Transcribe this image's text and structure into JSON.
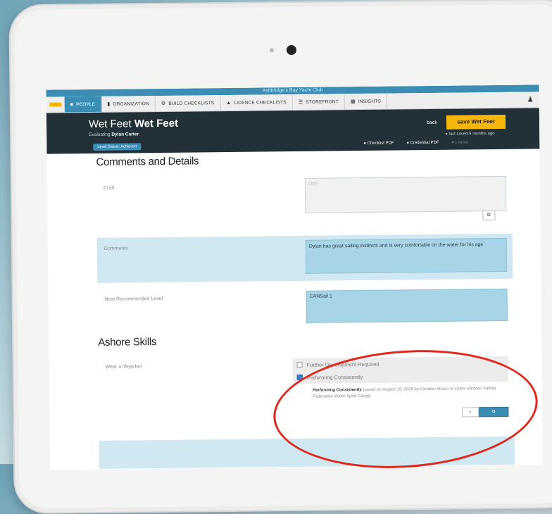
{
  "topbar": {
    "text": "Ashbridge's Bay Yacht Club"
  },
  "nav": {
    "tabs": [
      {
        "label": "PEOPLE",
        "icon": "people-icon",
        "active": true
      },
      {
        "label": "ORGANIZATION",
        "icon": "building-icon",
        "active": false
      },
      {
        "label": "BUILD CHECKLISTS",
        "icon": "gear-icon",
        "active": false
      },
      {
        "label": "LICENCE CHECKLISTS",
        "icon": "warning-icon",
        "active": false
      },
      {
        "label": "STOREFRONT",
        "icon": "store-icon",
        "active": false
      },
      {
        "label": "INSIGHTS",
        "icon": "chart-icon",
        "active": false
      }
    ],
    "user_icon": "user-icon"
  },
  "header": {
    "title_light": "Wet Feet",
    "title_bold": "Wet Feet",
    "sub_prefix": "Evaluating",
    "sub_name": "Dylan Carter",
    "status_badge": "Level Status: Achieved",
    "back_label": "back",
    "save_label": "save Wet Feet",
    "saved_text": "last saved 6 months ago",
    "links": [
      "Checklist PDF",
      "Credential PDF",
      "Logout"
    ]
  },
  "comments_section": {
    "title": "Comments and Details",
    "craft": {
      "label": "Craft",
      "placeholder": "Opti",
      "value": ""
    },
    "comments": {
      "label": "Comments",
      "value": "Dylan has great sailing instincts and is very comfortable on the water for his age."
    },
    "next_level": {
      "label": "Next Recommended Level",
      "value": "CANSail 1"
    }
  },
  "skills_section": {
    "title": "Ashore Skills",
    "skill": {
      "label": "Wear a lifejacket",
      "options": [
        {
          "label": "Further Development Required",
          "checked": false
        },
        {
          "label": "Performing Consistently",
          "checked": true
        }
      ],
      "note_bold": "Performing Consistently",
      "note_rest": " (saved on August 19, 2016 by Caroline Mauro at Outer Harbour Sailing Federation Water Sport Camp)"
    }
  },
  "colors": {
    "accent": "#3b8db3",
    "save": "#f5b70a",
    "header_bg": "#223037",
    "highlight_ring": "#e0271c"
  }
}
